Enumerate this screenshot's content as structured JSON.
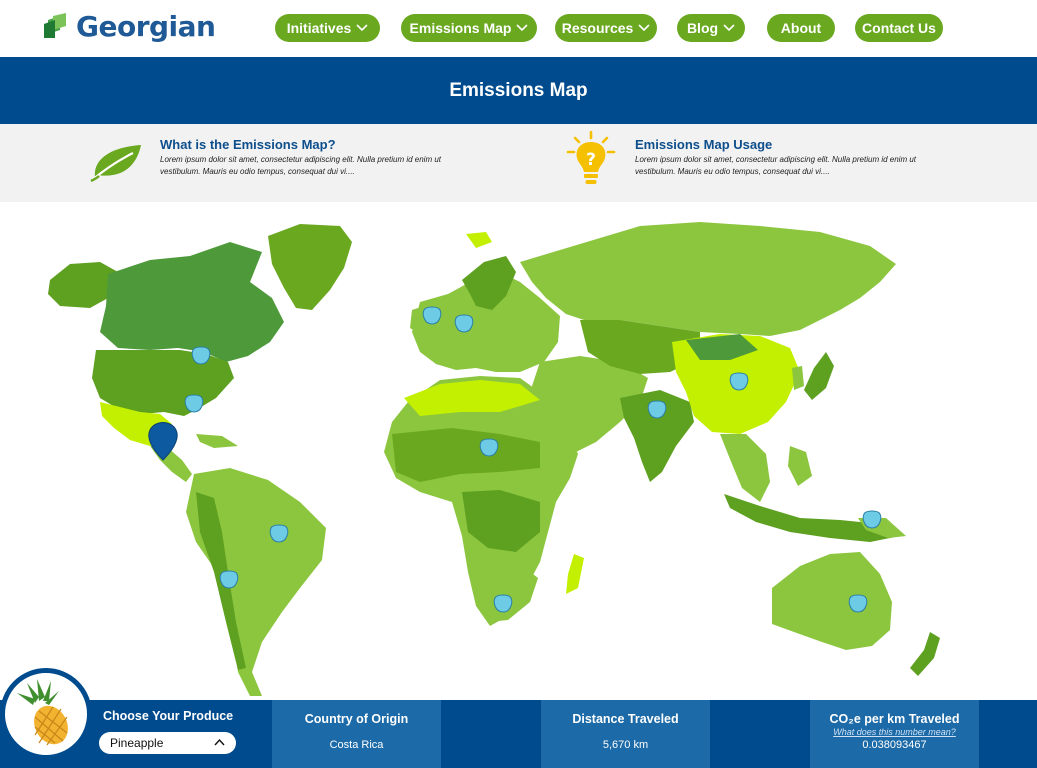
{
  "brand": {
    "name": "Georgian"
  },
  "nav": {
    "items": [
      {
        "label": "Initiatives",
        "dropdown": true
      },
      {
        "label": "Emissions Map",
        "dropdown": true
      },
      {
        "label": "Resources",
        "dropdown": true
      },
      {
        "label": "Blog",
        "dropdown": true
      },
      {
        "label": "About",
        "dropdown": false
      },
      {
        "label": "Contact Us",
        "dropdown": false
      }
    ]
  },
  "banner": {
    "title": "Emissions Map"
  },
  "info": {
    "what": {
      "title": "What is the Emissions Map?",
      "text": "Lorem ipsum dolor sit amet, consectetur adipiscing elit. Nulla pretium id enim ut vestibulum. Mauris eu odio tempus, consequat dui vi....",
      "icon": "leaf-icon"
    },
    "usage": {
      "title": "Emissions Map Usage",
      "text": "Lorem ipsum dolor sit amet, consectetur adipiscing elit. Nulla pretium id enim ut vestibulum. Mauris eu odio tempus, consequat dui vi....",
      "icon": "lightbulb-question-icon"
    }
  },
  "map": {
    "selected_origin": "Costa Rica",
    "colors": {
      "ocean": "#ffffff",
      "land_light": "#c3f000",
      "land_mid": "#8cc63f",
      "land_dark": "#5ea020",
      "land_darker": "#4e9a3a",
      "pin": "#6ecbe6",
      "pin_selected": "#0d5aa0"
    }
  },
  "bottom": {
    "produce": {
      "label": "Choose Your Produce",
      "selected": "Pineapple",
      "icon": "pineapple-icon"
    },
    "origin": {
      "title": "Country of Origin",
      "value": "Costa Rica"
    },
    "distance": {
      "title": "Distance Traveled",
      "value": "5,670 km"
    },
    "co2": {
      "title": "CO₂e per km Traveled",
      "link": "What does this number mean?",
      "value": "0.038093467"
    }
  },
  "colors": {
    "brand_green": "#6aa820",
    "brand_blue": "#004b8d",
    "panel_blue": "#1c6aa8"
  }
}
